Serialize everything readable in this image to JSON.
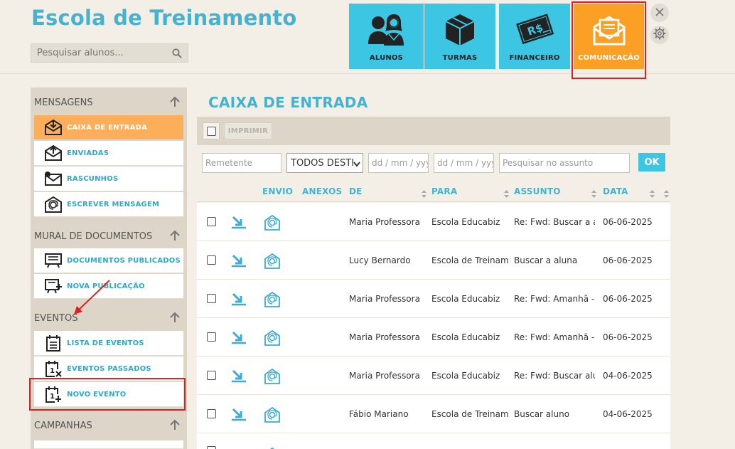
{
  "app": {
    "title": "Escola de Treinamento",
    "search_placeholder": "Pesquisar alunos..."
  },
  "modules": [
    {
      "label": "ALUNOS",
      "icon": "users-icon"
    },
    {
      "label": "TURMAS",
      "icon": "box-icon"
    },
    {
      "label": "FINANCEIRO",
      "icon": "money-icon"
    },
    {
      "label": "COMUNICAÇÃO",
      "icon": "envelope-icon",
      "active": true
    }
  ],
  "sidebar": {
    "sections": [
      {
        "title": "MENSAGENS",
        "items": [
          {
            "label": "CAIXA DE ENTRADA",
            "icon": "inbox-icon",
            "active": true
          },
          {
            "label": "ENVIADAS",
            "icon": "sent-icon"
          },
          {
            "label": "RASCUNHOS",
            "icon": "draft-icon"
          },
          {
            "label": "ESCREVER MENSAGEM",
            "icon": "compose-icon"
          }
        ]
      },
      {
        "title": "MURAL DE DOCUMENTOS",
        "items": [
          {
            "label": "DOCUMENTOS PUBLICADOS",
            "icon": "board-icon"
          },
          {
            "label": "NOVA PUBLICAÇÃO",
            "icon": "board-add-icon"
          }
        ]
      },
      {
        "title": "EVENTOS",
        "items": [
          {
            "label": "LISTA DE EVENTOS",
            "icon": "event-list-icon"
          },
          {
            "label": "EVENTOS PASSADOS",
            "icon": "event-past-icon"
          },
          {
            "label": "NOVO EVENTO",
            "icon": "event-add-icon"
          }
        ]
      },
      {
        "title": "CAMPANHAS",
        "items": []
      }
    ]
  },
  "main": {
    "title": "CAIXA DE ENTRADA",
    "print_label": "IMPRIMIR",
    "filters": {
      "sender_placeholder": "Remetente",
      "recipient_selected": "TODOS DESTI",
      "date_from_placeholder": "dd / mm / yyyy",
      "date_to_placeholder": "dd / mm / yyyy",
      "subject_placeholder": "Pesquisar no assunto",
      "ok_label": "OK"
    },
    "columns": {
      "envio": "ENVIO",
      "anexos": "ANEXOS",
      "de": "DE",
      "para": "PARA",
      "assunto": "ASSUNTO",
      "data": "DATA"
    },
    "rows": [
      {
        "de": "Maria Professora",
        "para": "Escola Educabiz",
        "assunto": "Re: Fwd: Buscar a al",
        "data": "06-06-2025"
      },
      {
        "de": "Lucy Bernardo",
        "para": "Escola de Treinam",
        "assunto": "Buscar a aluna",
        "data": "06-06-2025"
      },
      {
        "de": "Maria Professora",
        "para": "Escola Educabiz",
        "assunto": "Re: Fwd: Amanhã - L",
        "data": "06-06-2025"
      },
      {
        "de": "Maria Professora",
        "para": "Escola Educabiz",
        "assunto": "Re: Fwd: Amanhã - L",
        "data": "06-06-2025"
      },
      {
        "de": "Maria Professora",
        "para": "Escola Educabiz",
        "assunto": "Re: Fwd: Buscar alun",
        "data": "04-06-2025"
      },
      {
        "de": "Fábio Mariano",
        "para": "Escola de Treinam",
        "assunto": "Buscar aluno",
        "data": "04-06-2025"
      }
    ]
  },
  "colors": {
    "accent": "#45b3cf",
    "tile": "#3dc6e3",
    "tile_active": "#fba024",
    "sidebar_active": "#fcae5a",
    "highlight": "#e02020"
  }
}
